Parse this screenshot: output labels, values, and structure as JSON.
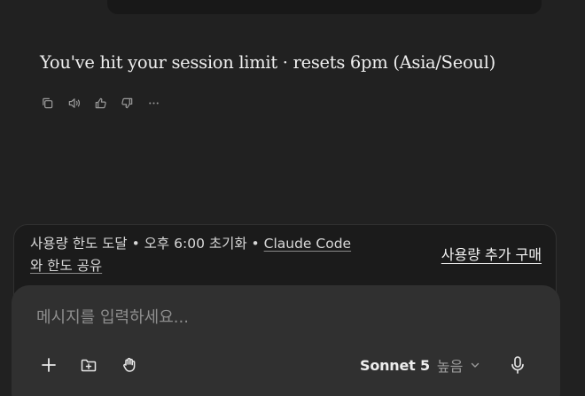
{
  "message": {
    "text": "You've hit your session limit · resets 6pm (Asia/Seoul)"
  },
  "actions": [
    {
      "icon": "copy-icon"
    },
    {
      "icon": "speaker-icon"
    },
    {
      "icon": "thumbs-up-icon"
    },
    {
      "icon": "thumbs-down-icon"
    },
    {
      "icon": "more-icon"
    }
  ],
  "banner": {
    "part1": "사용량 한도 도달 • 오후 6:00 초기화 • ",
    "link": "Claude Code",
    "line2": "와 한도 공유",
    "buy_label": "사용량 추가 구매"
  },
  "composer": {
    "placeholder": "메시지를 입력하세요...",
    "model": "Sonnet 5",
    "level": "높음"
  }
}
